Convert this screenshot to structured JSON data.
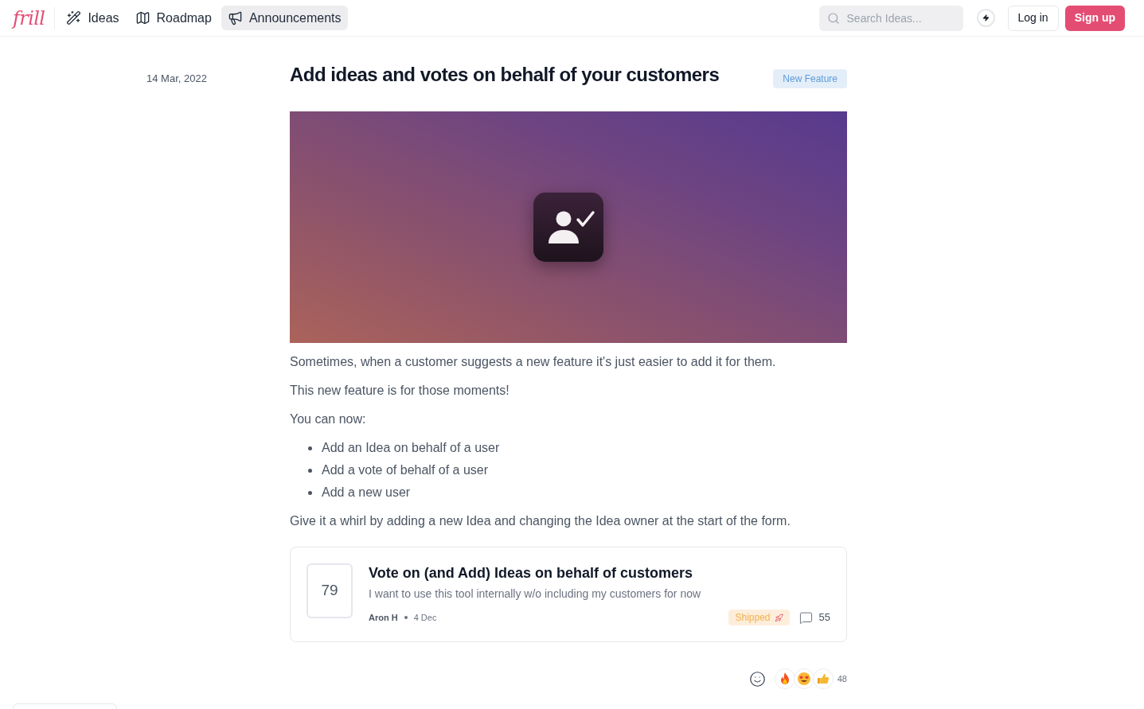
{
  "header": {
    "logo": "frill",
    "tabs": [
      {
        "label": "Ideas",
        "selected": false
      },
      {
        "label": "Roadmap",
        "selected": false
      },
      {
        "label": "Announcements",
        "selected": true
      }
    ],
    "search": {
      "placeholder": "Search Ideas..."
    },
    "buttons": [
      {
        "label": "Log in",
        "kind": "outline"
      },
      {
        "label": "Sign up",
        "kind": "primary"
      }
    ]
  },
  "announcement": {
    "date": "14 Mar, 2022",
    "title": "Add ideas and votes on behalf of your customers",
    "tag": "New Feature",
    "body": [
      {
        "kind": "paragraph",
        "text": "Sometimes, when a customer suggests a new feature it's just easier to add it for them."
      },
      {
        "kind": "paragraph",
        "text": "This new feature is for those moments!"
      },
      {
        "kind": "paragraph",
        "text": "You can now:"
      },
      {
        "kind": "list",
        "items": [
          "Add an Idea on behalf of a user",
          "Add a vote of behalf of a user",
          "Add a new user"
        ]
      },
      {
        "kind": "paragraph",
        "text": "Give it a whirl by adding a new Idea and changing the Idea owner at the start of the form."
      }
    ]
  },
  "linked_idea": {
    "votes": "79",
    "title": "Vote on (and Add) Ideas on behalf of customers",
    "description": "I want to use this tool internally w/o including my customers for now",
    "author": "Aron H",
    "date": "4 Dec",
    "status": "Shipped",
    "comments": "55"
  },
  "reactions": {
    "count": "48"
  }
}
